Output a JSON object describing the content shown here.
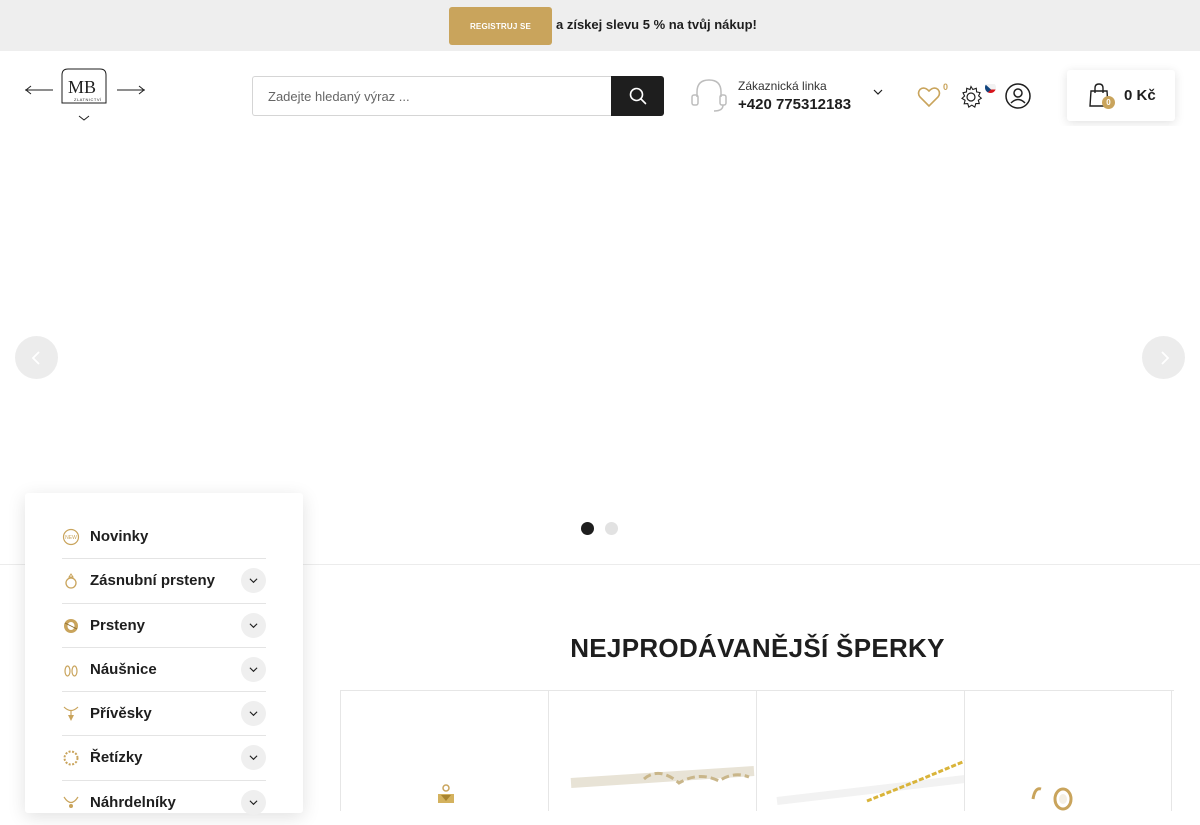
{
  "promo": {
    "register_label": "REGISTRUJ SE",
    "text": "a získej slevu 5 % na tvůj nákup!"
  },
  "logo": {
    "text": "MB",
    "subtext": "ZLATNICTVÍ"
  },
  "search": {
    "placeholder": "Zadejte hledaný výraz ...",
    "value": ""
  },
  "support": {
    "label": "Zákaznická linka",
    "phone": "+420 775312183"
  },
  "wishlist": {
    "count": "0"
  },
  "cart": {
    "count": "0",
    "total": "0 Kč"
  },
  "slider": {
    "slides": 2,
    "active_slide": 1
  },
  "menu": {
    "items": [
      {
        "label": "Novinky",
        "icon": "new-icon",
        "has_submenu": false
      },
      {
        "label": "Zásnubní prsteny",
        "icon": "engagement-ring-icon",
        "has_submenu": true
      },
      {
        "label": "Prsteny",
        "icon": "ring-icon",
        "has_submenu": true
      },
      {
        "label": "Náušnice",
        "icon": "earrings-icon",
        "has_submenu": true
      },
      {
        "label": "Přívěsky",
        "icon": "pendant-icon",
        "has_submenu": true
      },
      {
        "label": "Řetízky",
        "icon": "chain-icon",
        "has_submenu": true
      },
      {
        "label": "Náhrdelníky",
        "icon": "necklace-icon",
        "has_submenu": true
      }
    ]
  },
  "bestsellers": {
    "title": "NEJPRODÁVANĚJŠÍ ŠPERKY",
    "products": [
      {
        "image": "gold-pendant-image"
      },
      {
        "image": "white-gold-chain-image"
      },
      {
        "image": "gold-chain-image"
      },
      {
        "image": "gold-earring-image"
      }
    ]
  },
  "colors": {
    "accent": "#c9a45c",
    "dark": "#1e1e1e",
    "topbar": "#eeeeee"
  }
}
